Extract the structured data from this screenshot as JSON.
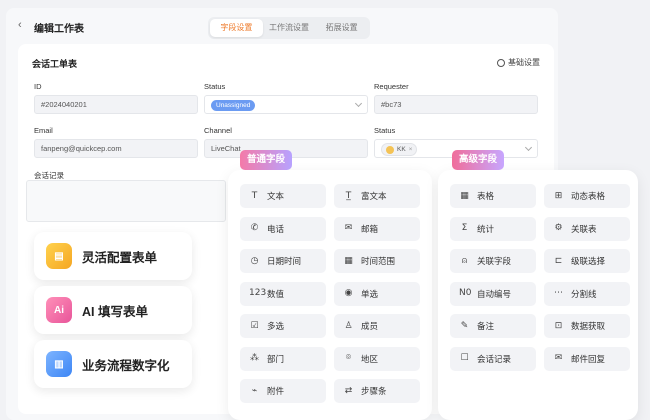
{
  "header": {
    "back_icon": "‹",
    "title": "编辑工作表",
    "tabs": [
      {
        "label": "字段设置",
        "active": true
      },
      {
        "label": "工作流设置",
        "active": false
      },
      {
        "label": "拓展设置",
        "active": false
      }
    ]
  },
  "form": {
    "title": "会话工单表",
    "basic_settings": "基础设置",
    "fields": {
      "id": {
        "label": "ID",
        "value": "#2024040201"
      },
      "status1": {
        "label": "Status",
        "value": "Unassigned"
      },
      "requester": {
        "label": "Requester",
        "value": "#bc73"
      },
      "email": {
        "label": "Email",
        "value": "fanpeng@quickcep.com"
      },
      "channel": {
        "label": "Channel",
        "value": "LiveChat"
      },
      "status2": {
        "label": "Status",
        "value": "KK"
      },
      "conversation": {
        "label": "会话记录"
      }
    }
  },
  "features": [
    {
      "label": "灵活配置表单",
      "icon": "form-icon",
      "color": "#f7b733"
    },
    {
      "label": "AI 填写表单",
      "icon": "ai-icon",
      "color": "#f06ba8"
    },
    {
      "label": "业务流程数字化",
      "icon": "chart-icon",
      "color": "#5a9cf8"
    }
  ],
  "panels": {
    "normal": {
      "title": "普通字段",
      "color": "#f06fa6",
      "items": [
        {
          "label": "文本",
          "glyph": "T",
          "icon": "text-icon"
        },
        {
          "label": "富文本",
          "glyph": "T̲",
          "icon": "rich-text-icon"
        },
        {
          "label": "电话",
          "glyph": "✆",
          "icon": "phone-icon"
        },
        {
          "label": "邮箱",
          "glyph": "✉",
          "icon": "mail-icon"
        },
        {
          "label": "日期时间",
          "glyph": "◷",
          "icon": "clock-icon"
        },
        {
          "label": "时间范围",
          "glyph": "▦",
          "icon": "calendar-icon"
        },
        {
          "label": "数值",
          "glyph": "123",
          "icon": "number-icon"
        },
        {
          "label": "单选",
          "glyph": "◉",
          "icon": "radio-icon"
        },
        {
          "label": "多选",
          "glyph": "☑",
          "icon": "checkbox-icon"
        },
        {
          "label": "成员",
          "glyph": "♙",
          "icon": "member-icon"
        },
        {
          "label": "部门",
          "glyph": "⁂",
          "icon": "department-icon"
        },
        {
          "label": "地区",
          "glyph": "⌾",
          "icon": "location-icon"
        },
        {
          "label": "附件",
          "glyph": "⌁",
          "icon": "attachment-icon"
        },
        {
          "label": "步骤条",
          "glyph": "⇄",
          "icon": "steps-icon"
        }
      ]
    },
    "advanced": {
      "title": "高级字段",
      "color": "#f0729a",
      "items": [
        {
          "label": "表格",
          "glyph": "▦",
          "icon": "table-icon"
        },
        {
          "label": "动态表格",
          "glyph": "⊞",
          "icon": "dynamic-table-icon"
        },
        {
          "label": "统计",
          "glyph": "Σ",
          "icon": "sum-icon"
        },
        {
          "label": "关联表",
          "glyph": "⚙",
          "icon": "relation-table-icon"
        },
        {
          "label": "关联字段",
          "glyph": "⍝",
          "icon": "relation-field-icon"
        },
        {
          "label": "级联选择",
          "glyph": "⊏",
          "icon": "cascade-icon"
        },
        {
          "label": "自动编号",
          "glyph": "N0",
          "icon": "auto-number-icon"
        },
        {
          "label": "分割线",
          "glyph": "⋯",
          "icon": "divider-icon"
        },
        {
          "label": "备注",
          "glyph": "✎",
          "icon": "note-icon"
        },
        {
          "label": "数据获取",
          "glyph": "⊡",
          "icon": "data-fetch-icon"
        },
        {
          "label": "会话记录",
          "glyph": "☐",
          "icon": "conversation-icon"
        },
        {
          "label": "邮件回复",
          "glyph": "✉",
          "icon": "mail-reply-icon"
        }
      ]
    }
  }
}
